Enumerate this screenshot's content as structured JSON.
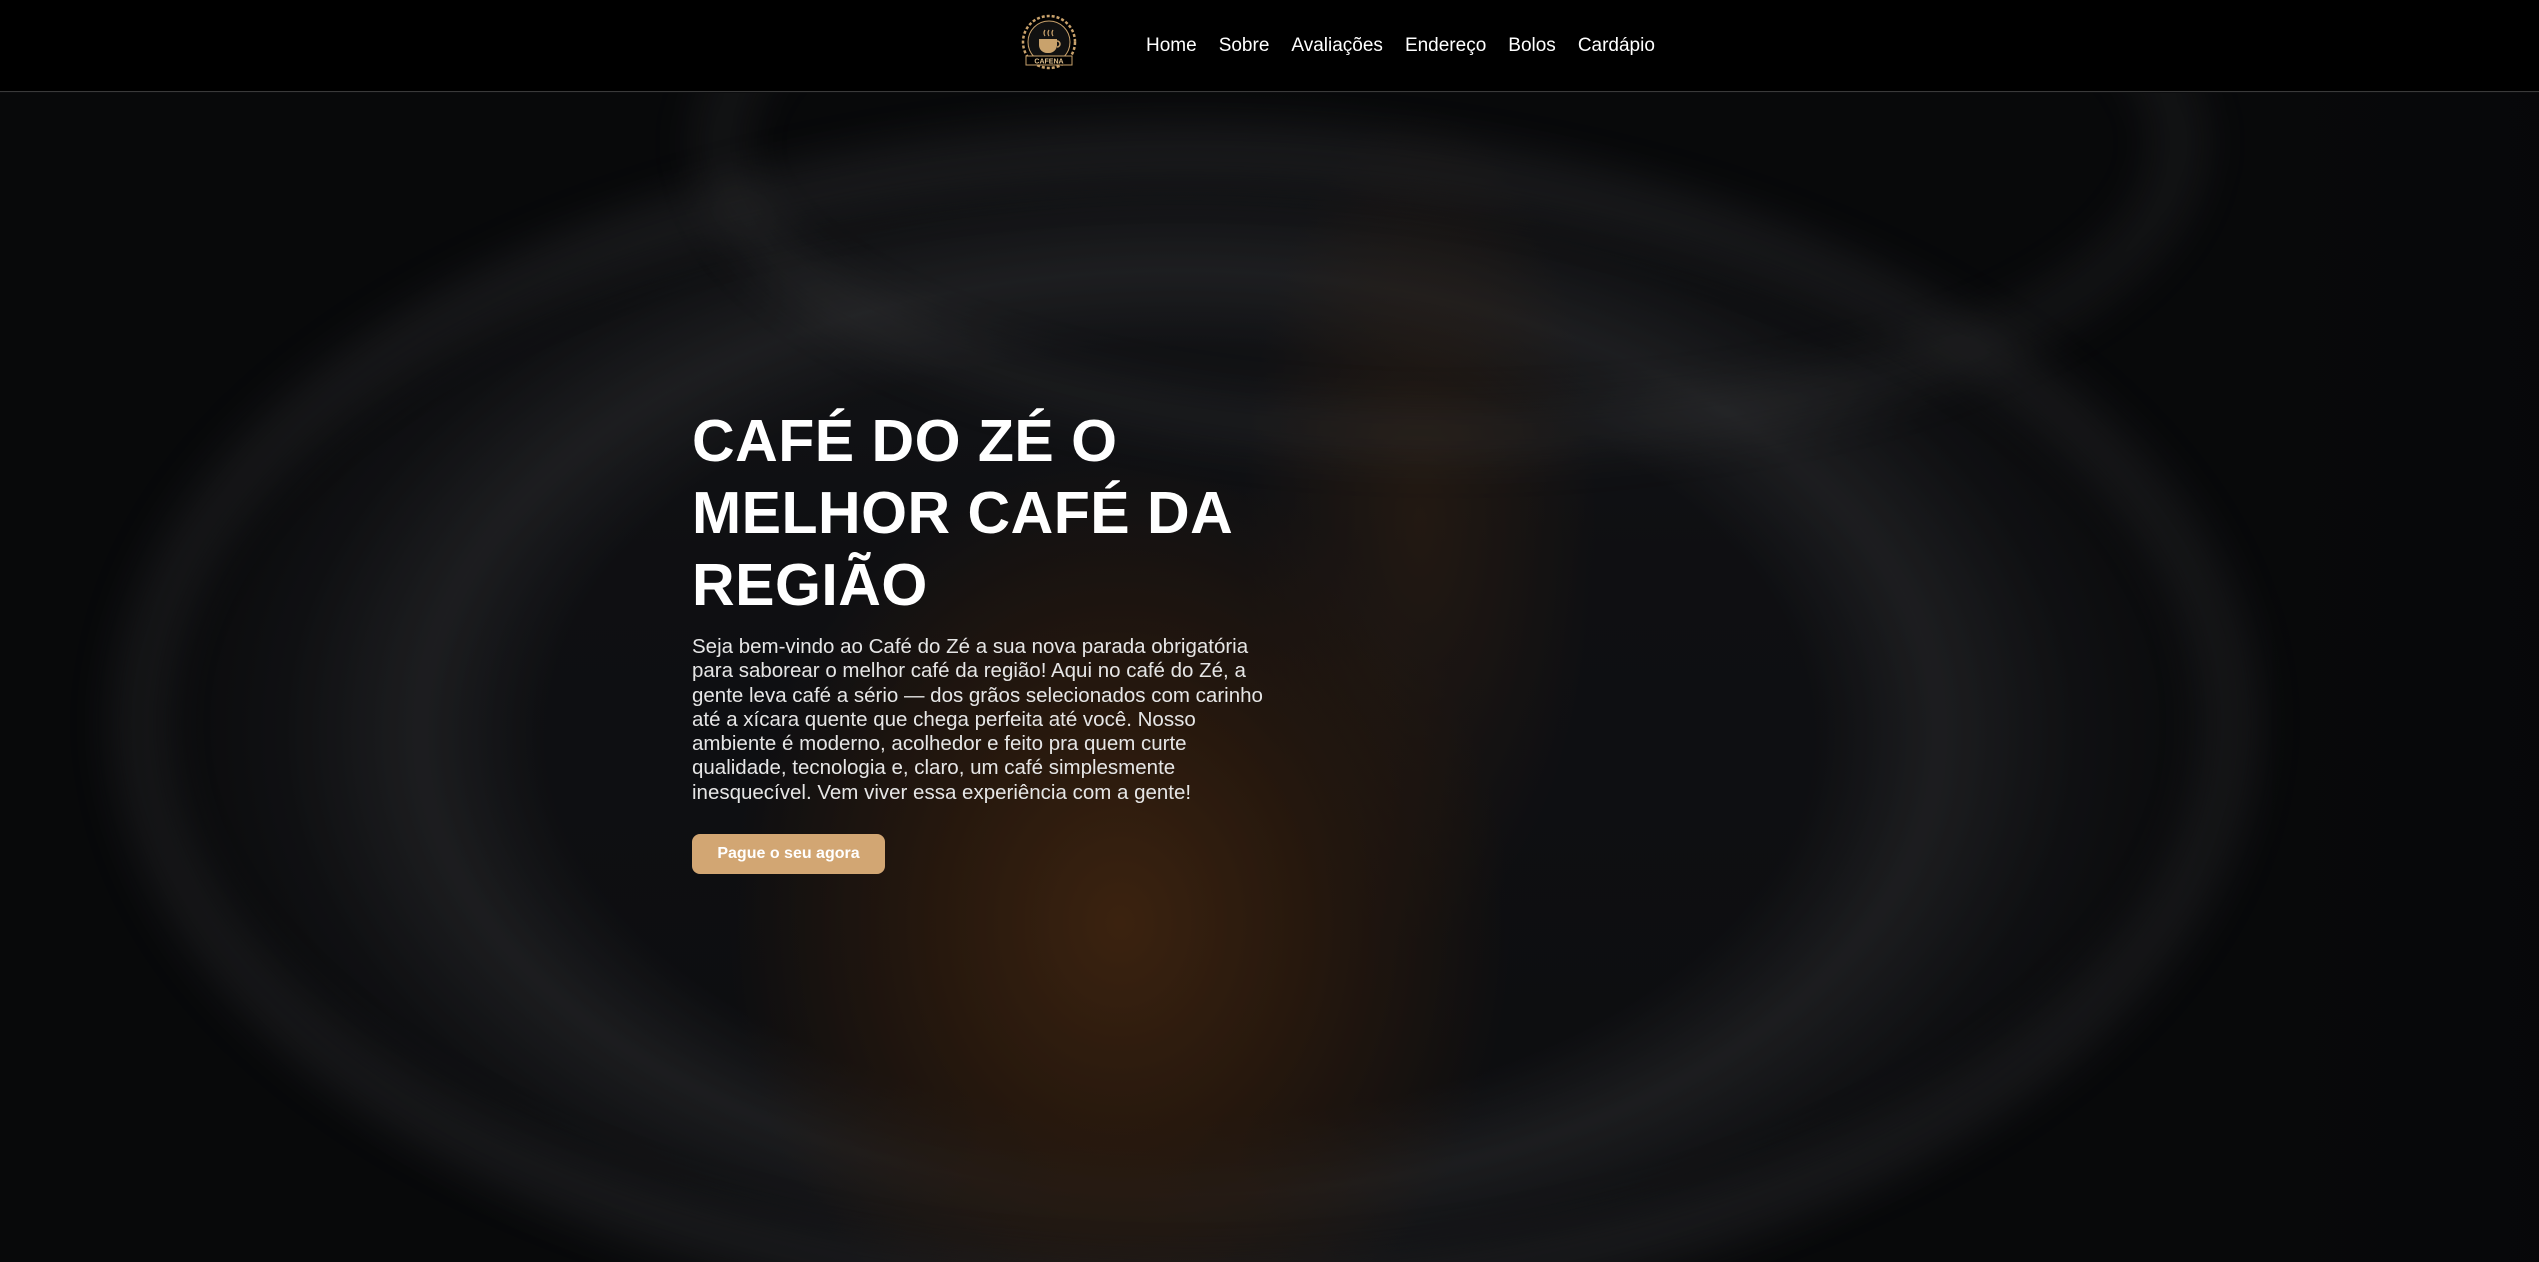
{
  "brand": {
    "logo_text": "CAFENA"
  },
  "nav": {
    "items": [
      {
        "label": "Home"
      },
      {
        "label": "Sobre"
      },
      {
        "label": "Avaliações"
      },
      {
        "label": "Endereço"
      },
      {
        "label": "Bolos"
      },
      {
        "label": "Cardápio"
      }
    ]
  },
  "hero": {
    "title_lines": [
      "CAFÉ DO ZÉ O",
      "MELHOR CAFÉ DA",
      "REGIÃO"
    ],
    "description": "Seja bem-vindo ao Café do Zé a sua nova parada obrigatória para saborear o melhor café da região! Aqui no café do Zé, a gente leva café a sério — dos grãos selecionados com carinho até a xícara quente que chega perfeita até você. Nosso ambiente é moderno, acolhedor e feito pra quem curte qualidade, tecnologia e, claro, um café simplesmente inesquecível. Vem viver essa experiência com a gente!",
    "cta_label": "Pague o seu agora"
  },
  "colors": {
    "nav_bg": "#000000",
    "accent": "#d2a673",
    "text": "#ffffff"
  },
  "icons": {
    "logo": "coffee-cup-emblem-icon"
  }
}
